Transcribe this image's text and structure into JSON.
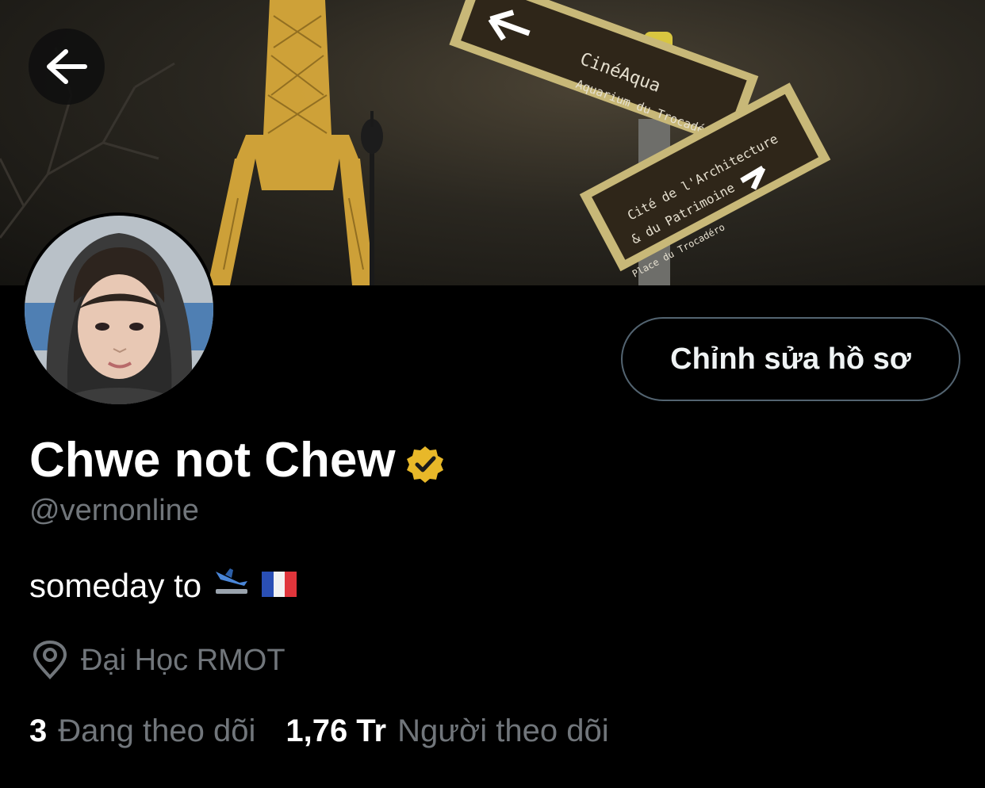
{
  "profile": {
    "display_name": "Chwe not Chew",
    "handle": "@vernonline",
    "bio_text": "someday to",
    "bio_emojis": [
      "airplane-landing-emoji",
      "france-flag-emoji"
    ],
    "location": "Đại Học RMOT",
    "verified_badge_color": "#e8b829"
  },
  "actions": {
    "edit_profile_label": "Chỉnh sửa hồ sơ"
  },
  "stats": {
    "following_count": "3",
    "following_label": "Đang theo dõi",
    "followers_count": "1,76 Tr",
    "followers_label": "Người theo dõi"
  },
  "banner": {
    "sign_left_line1": "CinéAqua",
    "sign_left_line2": "Aquarium du Trocadéro",
    "sign_right_line1": "Cité de l'Architecture",
    "sign_right_line2": "& du Patrimoine",
    "sign_right_line3": "Place du Trocadéro"
  },
  "icons": {
    "back": "arrow-left-icon",
    "location": "map-pin-icon",
    "verified": "verified-badge-icon"
  },
  "colors": {
    "background": "#000000",
    "secondary_text": "#71767b",
    "primary_text": "#ffffff",
    "button_border": "#536471"
  }
}
